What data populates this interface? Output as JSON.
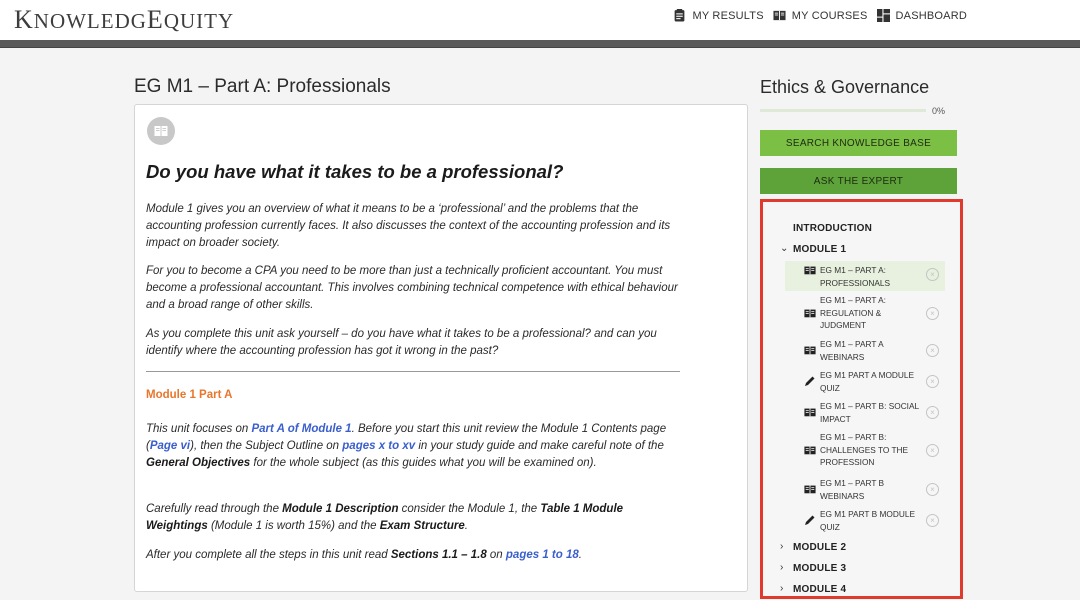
{
  "header": {
    "logo": "KnowledgEquity",
    "nav": [
      {
        "label": "MY RESULTS",
        "icon": "results-clipboard-icon"
      },
      {
        "label": "MY COURSES",
        "icon": "courses-book-icon"
      },
      {
        "label": "DASHBOARD",
        "icon": "dashboard-grid-icon"
      }
    ]
  },
  "main": {
    "title": "EG M1 – Part A: Professionals",
    "heading": "Do you have what it takes to be a professional?",
    "paragraphs": [
      "Module 1 gives you an overview of what it means to be a ‘professional’ and the problems that the accounting profession currently faces. It also discusses the context of the accounting profession and its impact on broader society.",
      "For you to become a CPA you need to be more than just a technically proficient accountant. You must become a professional accountant. This involves combining technical competence with ethical behaviour and a broad range of other skills.",
      "As you complete this unit ask yourself – do you have what it takes to be a professional? and can you identify where the accounting profession has got it wrong in the past?"
    ],
    "subheading": "Module 1 Part A",
    "p4": {
      "t1": "This unit focuses on ",
      "link1": "Part A of Module 1",
      "t2": ". Before you start this unit review the Module 1 Contents page (",
      "link2": "Page vi",
      "t3": "), then the Subject Outline on ",
      "link3": "pages x to xv",
      "t4": " in your study guide and make careful note of the ",
      "bold1": "General Objectives",
      "t5": " for the whole subject (as this guides what you will be examined on)."
    },
    "p5": {
      "t1": "Carefully read through the ",
      "bold1": "Module 1 Description",
      "t2": " consider the Module 1, the ",
      "bold2": "Table 1 Module Weightings",
      "t3": " (Module 1 is worth 15%) and the ",
      "bold3": "Exam Structure",
      "t4": "."
    },
    "p6": {
      "t1": "After you complete all the steps in this unit read ",
      "bold1": "Sections 1.1 – 1.8",
      "t2": " on ",
      "link1": "pages 1 to 18",
      "t3": "."
    }
  },
  "sidebar": {
    "title": "Ethics & Governance",
    "progress_value": 0,
    "progress_label": "0%",
    "search_button": "SEARCH KNOWLEDGE BASE",
    "expert_button": "ASK THE EXPERT",
    "sections": {
      "introduction": "INTRODUCTION",
      "module1": "MODULE 1",
      "module2": "MODULE 2",
      "module3": "MODULE 3",
      "module4": "MODULE 4"
    },
    "lessons": [
      {
        "label": "EG M1 – PART A: PROFESSIONALS",
        "icon": "book-icon",
        "active": true
      },
      {
        "label": "EG M1 – PART A: REGULATION & JUDGMENT",
        "icon": "book-icon",
        "active": false
      },
      {
        "label": "EG M1 – PART A WEBINARS",
        "icon": "book-icon",
        "active": false
      },
      {
        "label": "EG M1 PART A MODULE QUIZ",
        "icon": "pencil-icon",
        "active": false
      },
      {
        "label": "EG M1 – PART B: SOCIAL IMPACT",
        "icon": "book-icon",
        "active": false
      },
      {
        "label": "EG M1 – PART B: CHALLENGES TO THE PROFESSION",
        "icon": "book-icon",
        "active": false
      },
      {
        "label": "EG M1 – PART B WEBINARS",
        "icon": "book-icon",
        "active": false
      },
      {
        "label": "EG M1 PART B MODULE QUIZ",
        "icon": "pencil-icon",
        "active": false
      }
    ],
    "highlight_color": "#e03a2f"
  },
  "colors": {
    "accent_orange": "#e8762c",
    "link_blue": "#3a5fcd",
    "button_green_light": "#7bbf45",
    "button_green_dark": "#5da339"
  }
}
